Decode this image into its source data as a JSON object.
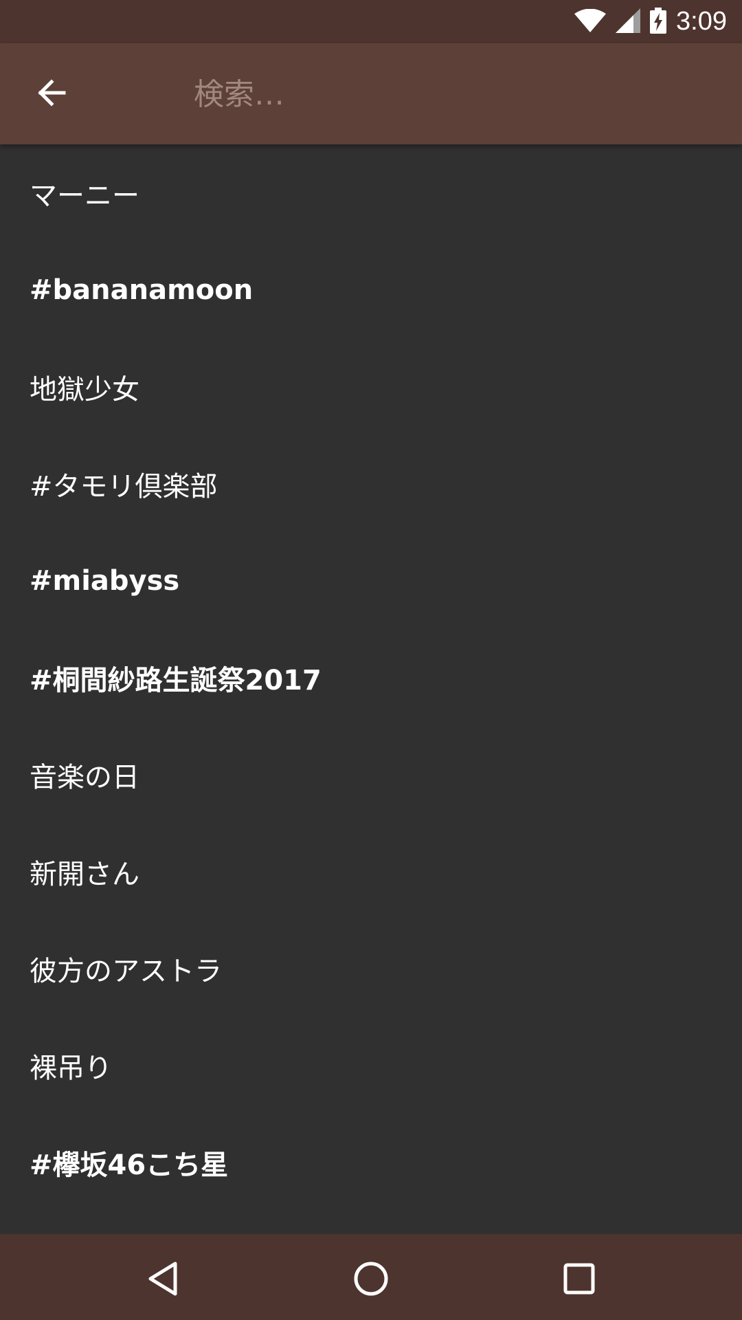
{
  "status_bar": {
    "time": "3:09",
    "icons": [
      "wifi-icon",
      "cell-signal-icon",
      "battery-charging-icon"
    ]
  },
  "search": {
    "placeholder": "検索…",
    "value": "",
    "back_icon": "arrow-left-icon"
  },
  "suggestions": [
    {
      "label": "マーニー"
    },
    {
      "label": "#bananamoon"
    },
    {
      "label": "地獄少女"
    },
    {
      "label": "#タモリ倶楽部"
    },
    {
      "label": "#miabyss"
    },
    {
      "label": "#桐間紗路生誕祭2017"
    },
    {
      "label": "音楽の日"
    },
    {
      "label": "新開さん"
    },
    {
      "label": "彼方のアストラ"
    },
    {
      "label": "裸吊り"
    },
    {
      "label": "#欅坂46こち星"
    }
  ],
  "nav_bar": {
    "icons": [
      "back-triangle-icon",
      "home-circle-icon",
      "recents-square-icon"
    ]
  },
  "colors": {
    "status_bar": "#4e342e",
    "app_bar": "#5d4037",
    "background": "#303030",
    "nav_bar": "#4e342e",
    "placeholder": "#a1887f"
  }
}
